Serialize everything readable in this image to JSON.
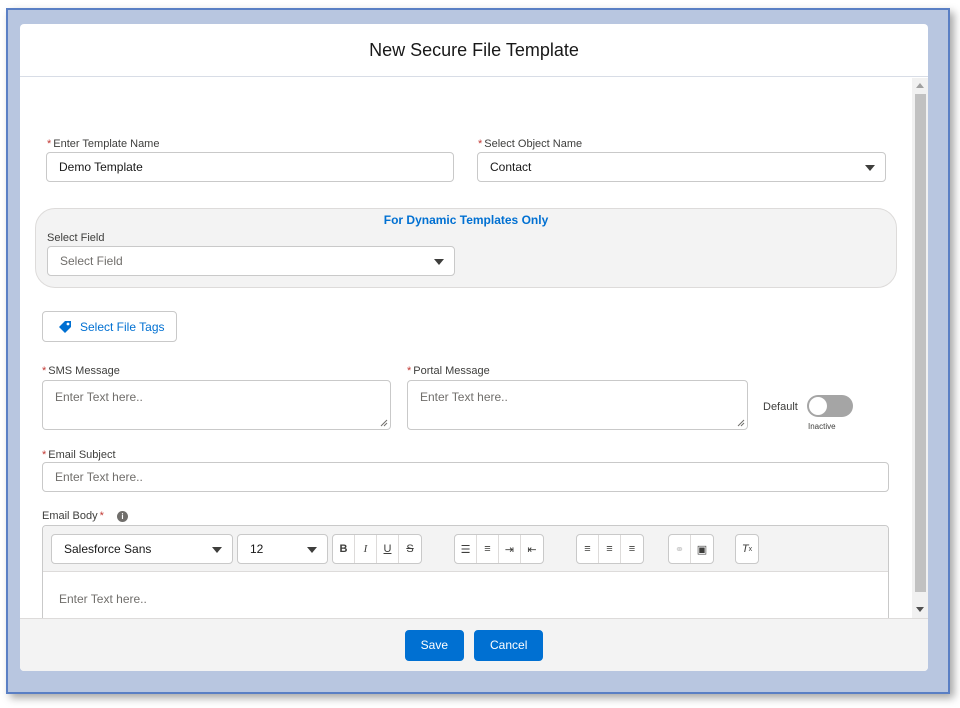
{
  "modal": {
    "title": "New Secure File Template"
  },
  "form": {
    "template_name": {
      "label": "Enter Template Name",
      "value": "Demo Template"
    },
    "object_name": {
      "label": "Select Object Name",
      "value": "Contact"
    },
    "dynamic": {
      "title": "For Dynamic Templates Only",
      "field_label": "Select Field",
      "field_placeholder": "Select Field"
    },
    "file_tags_button": "Select File Tags",
    "sms_message": {
      "label": "SMS Message",
      "placeholder": "Enter Text here.."
    },
    "portal_message": {
      "label": "Portal Message",
      "placeholder": "Enter Text here.."
    },
    "default_toggle": {
      "label": "Default",
      "state": "Inactive"
    },
    "email_subject": {
      "label": "Email Subject",
      "placeholder": "Enter Text here.."
    },
    "email_body": {
      "label": "Email Body",
      "font_family": "Salesforce Sans",
      "font_size": "12",
      "placeholder": "Enter Text here.."
    }
  },
  "footer": {
    "save_label": "Save",
    "cancel_label": "Cancel"
  },
  "colors": {
    "brand": "#0070d2",
    "required": "#c23934"
  }
}
